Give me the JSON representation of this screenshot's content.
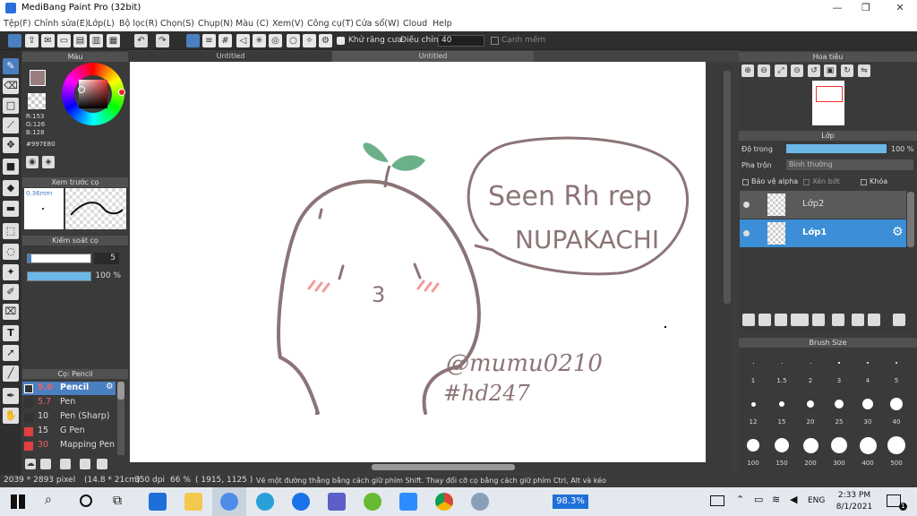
{
  "window": {
    "title": "MediBang Paint Pro (32bit)",
    "min": "—",
    "max": "❐",
    "close": "✕"
  },
  "menu": [
    "Tệp(F)",
    "Chỉnh sửa(E)",
    "Lớp(L)",
    "Bộ lọc(R)",
    "Chọn(S)",
    "Chụp(N)",
    "Màu (C)",
    "Xem(V)",
    "Công cụ(T)",
    "Cửa sổ(W)",
    "Cloud",
    "Help"
  ],
  "toolbar": {
    "antialias": "Khử răng cưa",
    "adjust": "Điều chỉnh",
    "adjust_value": "40",
    "edge": "Cạnh mềm"
  },
  "tabs": [
    "Untitled",
    "Untitled"
  ],
  "color_panel": {
    "title": "Màu",
    "r": "R:153",
    "g": "G:126",
    "b": "B:128",
    "hex": "#997E80",
    "fg": "#997e80"
  },
  "brush_preview": {
    "title": "Xem trước cọ",
    "size": "0.36mm"
  },
  "brush_control": {
    "title": "Kiểm soát cọ",
    "size": "5",
    "opacity": "100 %"
  },
  "brush_list": {
    "title": "Cọ: Pencil",
    "items": [
      {
        "size": "5.0",
        "name": "Pencil",
        "color": "#333333"
      },
      {
        "size": "5.7",
        "name": "Pen",
        "color": "#333333"
      },
      {
        "size": "10",
        "name": "Pen (Sharp)",
        "color": "#333333"
      },
      {
        "size": "15",
        "name": "G Pen",
        "color": "#e04040"
      },
      {
        "size": "30",
        "name": "Mapping Pen",
        "color": "#e04040"
      }
    ]
  },
  "navigator": {
    "title": "Hoa tiêu"
  },
  "layer_panel": {
    "title": "Lớp",
    "opacity_label": "Độ trong",
    "opacity": "100 %",
    "blend_label": "Pha trộn",
    "blend": "Bình thường",
    "protect_alpha": "Bảo vệ alpha",
    "clip": "Xén bớt",
    "lock": "Khóa",
    "layers": [
      {
        "name": "Lớp2"
      },
      {
        "name": "Lớp1"
      }
    ]
  },
  "brush_size": {
    "title": "Brush Size",
    "sizes": [
      "1",
      "1.5",
      "2",
      "3",
      "4",
      "5",
      "12",
      "15",
      "20",
      "25",
      "30",
      "40",
      "100",
      "150",
      "200",
      "300",
      "400",
      "500"
    ]
  },
  "drawing": {
    "bubble1": "Seen Rh rep",
    "bubble2": "NUPAKACHI",
    "sig1": "@mumu0210",
    "sig2": "#hd247",
    "mouth": "3"
  },
  "status": {
    "size": "2039 * 2893 pixel",
    "cm": "(14.8 * 21cm)",
    "dpi": "350 dpi",
    "zoom": "66 %",
    "coord": "( 1915, 1125 )",
    "hint": "Vẽ một đường thẳng bằng cách giữ phím Shift. Thay đổi cỡ cọ bằng cách giữ phím Ctrl, Alt và kéo"
  },
  "taskbar": {
    "battery": "98.3%",
    "lang": "ENG",
    "time": "2:33 PM",
    "date": "8/1/2021",
    "notif": "1"
  }
}
